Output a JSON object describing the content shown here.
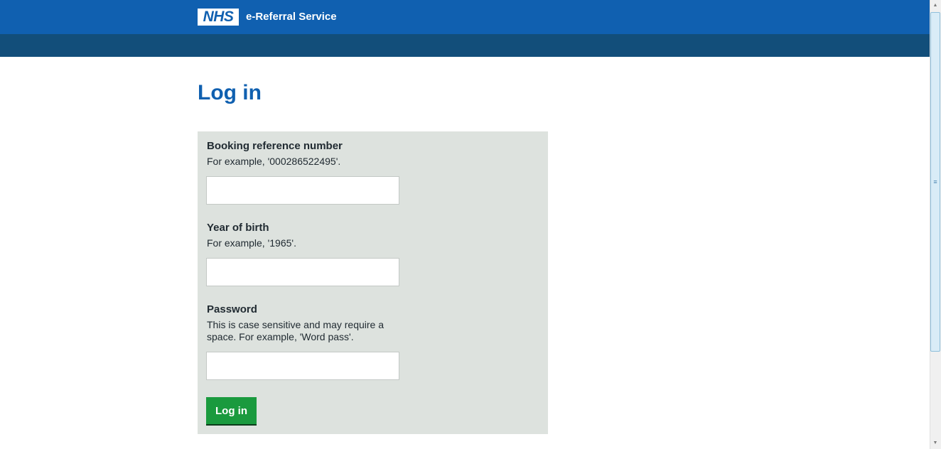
{
  "header": {
    "logo_text": "NHS",
    "service_name": "e-Referral Service"
  },
  "page": {
    "title": "Log in"
  },
  "form": {
    "booking": {
      "label": "Booking reference number",
      "hint": "For example, '000286522495'.",
      "value": ""
    },
    "year": {
      "label": "Year of birth",
      "hint": "For example, '1965'.",
      "value": ""
    },
    "password": {
      "label": "Password",
      "hint": "This is case sensitive and may require a space. For example, 'Word pass'.",
      "value": ""
    },
    "submit_label": "Log in"
  },
  "colors": {
    "header_blue": "#1060b0",
    "subbar_blue": "#124e7a",
    "panel_grey": "#dde2de",
    "button_green": "#1a9a3e"
  },
  "icons": {
    "scroll_up": "arrow-up-icon",
    "scroll_down": "arrow-down-icon",
    "grip": "grip-icon"
  }
}
